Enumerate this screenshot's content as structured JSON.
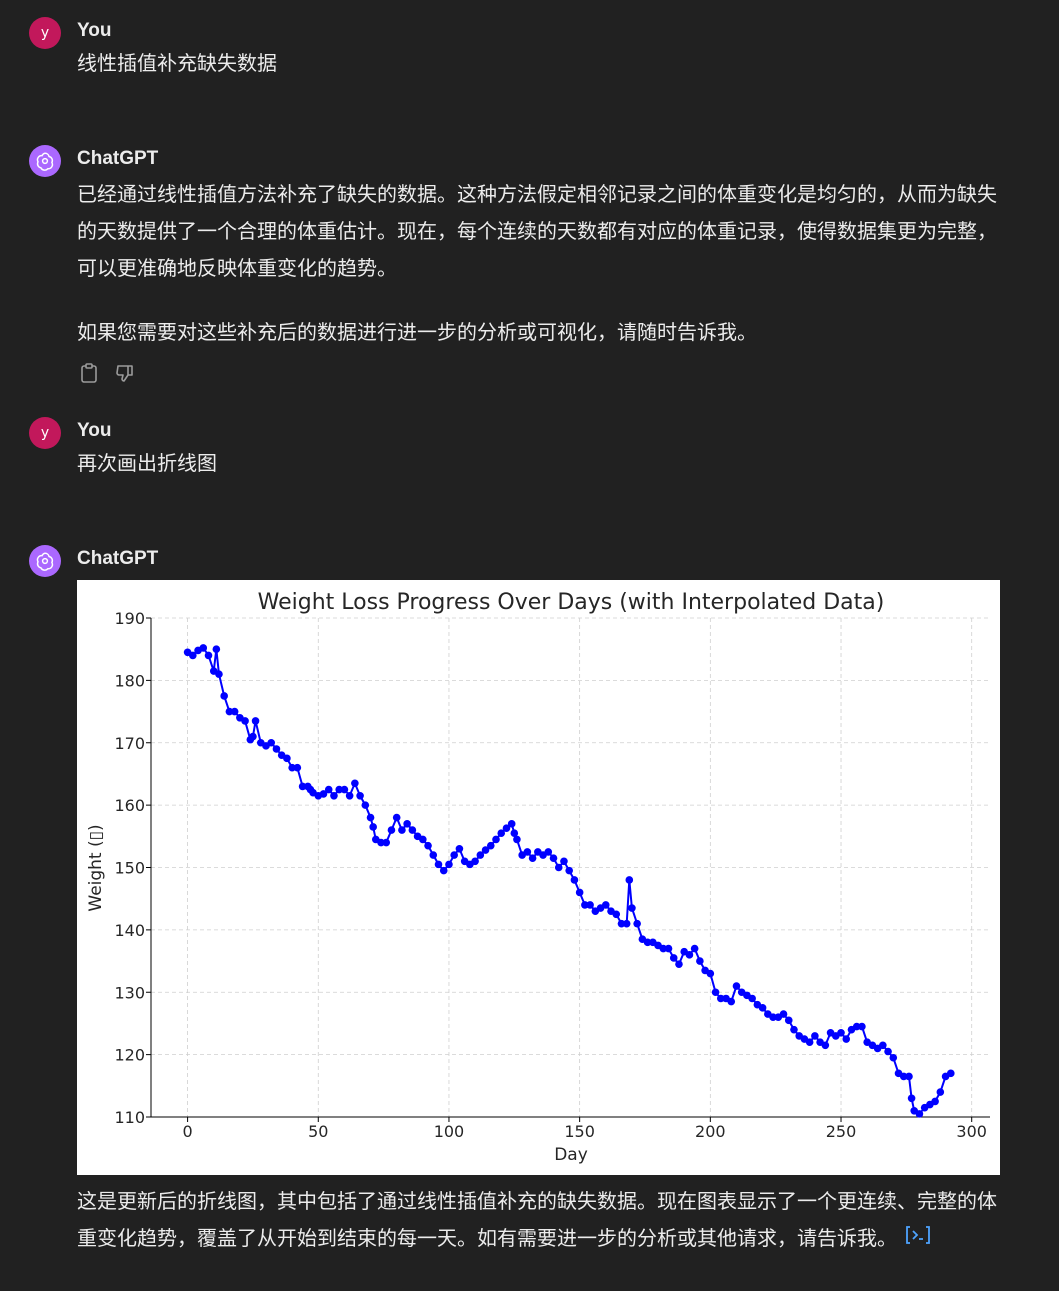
{
  "conversation": {
    "msg1": {
      "author": "You",
      "avatar_letter": "y",
      "text": "线性插值补充缺失数据"
    },
    "msg2": {
      "author": "ChatGPT",
      "para1": "已经通过线性插值方法补充了缺失的数据。这种方法假定相邻记录之间的体重变化是均匀的，从而为缺失的天数提供了一个合理的体重估计。现在，每个连续的天数都有对应的体重记录，使得数据集更为完整，可以更准确地反映体重变化的趋势。",
      "para2": "如果您需要对这些补充后的数据进行进一步的分析或可视化，请随时告诉我。",
      "actions": [
        "clipboard-icon",
        "thumbs-down-icon"
      ]
    },
    "msg3": {
      "author": "You",
      "avatar_letter": "y",
      "text": "再次画出折线图"
    },
    "msg4": {
      "author": "ChatGPT",
      "after_chart_text": "这是更新后的折线图，其中包括了通过线性插值补充的缺失数据。现在图表显示了一个更连续、完整的体重变化趋势，覆盖了从开始到结束的每一天。如有需要进一步的分析或其他请求，请告诉我。",
      "code_icon": "code-interpreter-icon"
    }
  },
  "colors": {
    "background": "#212121",
    "user_avatar": "#c2185b",
    "gpt_avatar": "#ab68ff",
    "series": "#0000ff"
  },
  "chart_data": {
    "type": "line",
    "title": "Weight Loss Progress Over Days (with Interpolated Data)",
    "xlabel": "Day",
    "ylabel": "Weight (▯)",
    "xlim": [
      -14,
      307
    ],
    "ylim": [
      110,
      190
    ],
    "xticks": [
      0,
      50,
      100,
      150,
      200,
      250,
      300
    ],
    "yticks": [
      110,
      120,
      130,
      140,
      150,
      160,
      170,
      180,
      190
    ],
    "grid": true,
    "markers": "circle",
    "series": [
      {
        "x": [
          0,
          2,
          4,
          6,
          8,
          10,
          11,
          12,
          14,
          16,
          18,
          20,
          22,
          24,
          25,
          26,
          28,
          30,
          32,
          34,
          36,
          38,
          40,
          42,
          44,
          46,
          47,
          48,
          50,
          52,
          54,
          56,
          58,
          60,
          62,
          64,
          66,
          68,
          70,
          71,
          72,
          74,
          76,
          78,
          80,
          82,
          84,
          86,
          88,
          90,
          92,
          94,
          96,
          98,
          100,
          102,
          104,
          106,
          108,
          110,
          112,
          114,
          116,
          118,
          120,
          122,
          124,
          125,
          126,
          128,
          130,
          132,
          134,
          136,
          138,
          140,
          142,
          144,
          146,
          148,
          150,
          152,
          154,
          156,
          158,
          160,
          162,
          164,
          166,
          168,
          169,
          170,
          172,
          174,
          176,
          178,
          180,
          182,
          184,
          186,
          188,
          190,
          192,
          194,
          196,
          198,
          200,
          202,
          204,
          206,
          208,
          210,
          212,
          214,
          216,
          218,
          220,
          222,
          224,
          226,
          228,
          230,
          232,
          234,
          236,
          238,
          240,
          242,
          244,
          246,
          248,
          250,
          252,
          254,
          256,
          258,
          260,
          262,
          264,
          266,
          268,
          270,
          272,
          274,
          276,
          277,
          278,
          280,
          282,
          284,
          286,
          288,
          290,
          292
        ],
        "y": [
          184.5,
          184,
          184.8,
          185.2,
          184,
          181.5,
          185,
          181,
          177.5,
          175,
          175,
          174,
          173.5,
          170.5,
          171,
          173.5,
          170,
          169.5,
          170,
          169,
          168,
          167.5,
          166,
          166,
          163,
          163,
          162.5,
          162,
          161.5,
          161.8,
          162.5,
          161.5,
          162.5,
          162.5,
          161.5,
          163.5,
          161.5,
          160,
          158,
          156.5,
          154.5,
          154,
          154,
          156,
          158,
          156,
          157,
          156,
          155,
          154.5,
          153.5,
          152,
          150.5,
          149.5,
          150.5,
          152,
          153,
          151,
          150.5,
          151,
          152,
          152.8,
          153.5,
          154.5,
          155.5,
          156.3,
          157,
          155.5,
          154.5,
          152,
          152.5,
          151.5,
          152.5,
          152,
          152.5,
          151.5,
          150,
          151,
          149.5,
          148,
          146,
          144,
          144,
          143,
          143.5,
          144,
          143,
          142.5,
          141,
          141,
          148,
          143.5,
          141,
          138.5,
          138,
          138,
          137.5,
          137,
          137,
          135.5,
          134.5,
          136.5,
          136,
          137,
          135,
          133.5,
          133,
          130,
          129,
          129,
          128.5,
          131,
          130,
          129.5,
          129,
          128,
          127.5,
          126.5,
          126,
          126,
          126.5,
          125.5,
          124,
          123,
          122.5,
          122,
          123,
          122,
          121.5,
          123.5,
          123,
          123.5,
          122.5,
          124,
          124.5,
          124.5,
          122,
          121.5,
          121,
          121.5,
          120.5,
          119.5,
          117,
          116.5,
          116.5,
          113,
          111,
          110.5,
          111.5,
          112,
          112.5,
          114,
          116.5,
          117
        ]
      }
    ]
  }
}
